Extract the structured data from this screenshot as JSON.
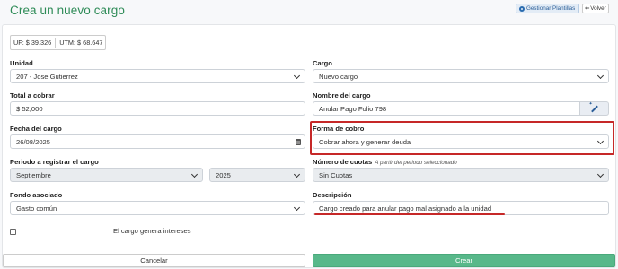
{
  "header": {
    "title": "Crea un nuevo cargo",
    "templates_button": "Gestionar Plantillas",
    "back_button": "Volver"
  },
  "indicators": {
    "uf": "UF: $ 39.326",
    "utm": "UTM: $ 68.647"
  },
  "form": {
    "unidad": {
      "label": "Unidad",
      "value": "207 - Jose Gutierrez"
    },
    "cargo": {
      "label": "Cargo",
      "value": "Nuevo cargo"
    },
    "total": {
      "label": "Total a cobrar",
      "value": "$ 52,000"
    },
    "nombre": {
      "label": "Nombre del cargo",
      "value": "Anular Pago Folio 798"
    },
    "fecha": {
      "label": "Fecha del cargo",
      "value": "26/08/2025"
    },
    "forma": {
      "label": "Forma de cobro",
      "value": "Cobrar ahora y generar deuda"
    },
    "periodo": {
      "label": "Periodo a registrar el cargo",
      "month": "Septiembre",
      "year": "2025"
    },
    "cuotas": {
      "label": "Número de cuotas",
      "hint": "A partir del periodo seleccionado",
      "value": "Sin Cuotas"
    },
    "fondo": {
      "label": "Fondo asociado",
      "value": "Gasto común"
    },
    "descripcion": {
      "label": "Descripción",
      "value": "Cargo creado para anular pago mal asignado a la unidad"
    },
    "intereses_label": "El cargo genera intereses"
  },
  "actions": {
    "cancel": "Cancelar",
    "create": "Crear"
  },
  "colors": {
    "accent": "#2e8b57",
    "create_button": "#58b88a",
    "highlight": "#c62828"
  },
  "icons": [
    "gear-icon",
    "back-arrow-icon",
    "chevron-down-icon",
    "calendar-icon",
    "magic-wand-icon"
  ]
}
